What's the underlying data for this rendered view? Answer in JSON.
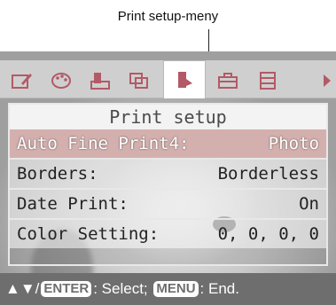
{
  "callout": {
    "label": "Print setup-meny"
  },
  "icons": [
    {
      "name": "edit-icon"
    },
    {
      "name": "creative-palette-icon"
    },
    {
      "name": "print-index-icon"
    },
    {
      "name": "image-layers-icon"
    },
    {
      "name": "print-setup-icon",
      "active": true
    },
    {
      "name": "toolbox-icon"
    },
    {
      "name": "file-cabinet-icon"
    }
  ],
  "menu": {
    "title": "Print setup",
    "rows": [
      {
        "label": "Auto Fine Print4:",
        "value": "Photo",
        "selected": true
      },
      {
        "label": "Borders:",
        "value": "Borderless"
      },
      {
        "label": "Date Print:",
        "value": "On"
      },
      {
        "label": "Color Setting:",
        "value": "0, 0, 0, 0"
      }
    ]
  },
  "hint": {
    "arrows": "▲▼/",
    "enter_key": "ENTER",
    "select_text": ": Select; ",
    "menu_key": "MENU",
    "end_text": ": End."
  },
  "colors": {
    "selected_row": "#d3b0ae",
    "hint_bar": "#6e6e6e",
    "accent": "#b35a66"
  }
}
